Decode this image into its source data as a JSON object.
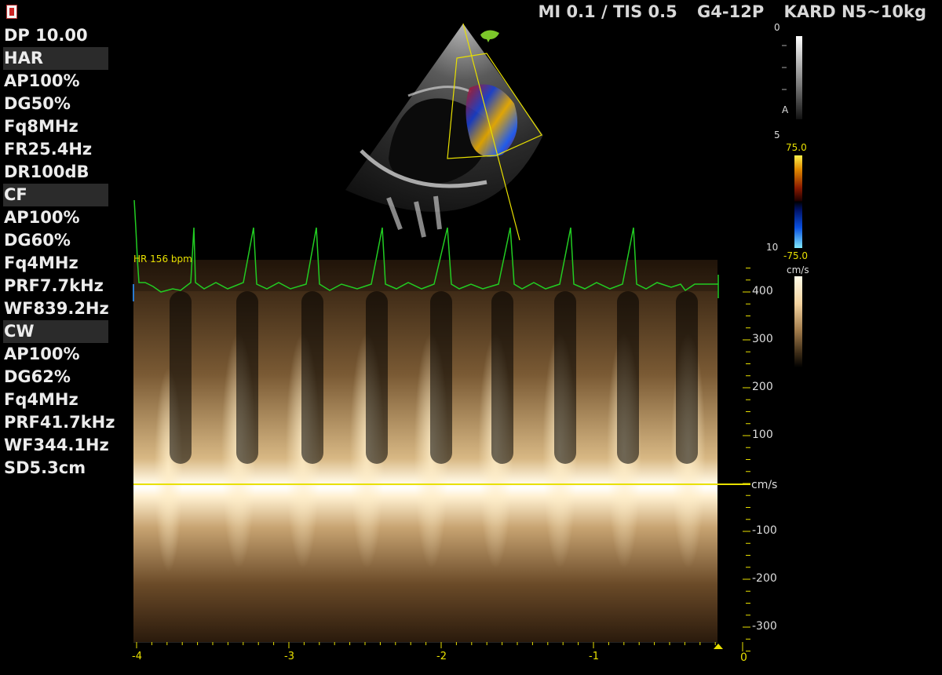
{
  "header": {
    "mi_tis": "MI 0.1 / TIS 0.5",
    "probe": "G4-12P",
    "preset": "KARD N5~10kg"
  },
  "params": [
    {
      "label": "DP 10.00",
      "mode": false
    },
    {
      "label": "HAR",
      "mode": true
    },
    {
      "label": "AP100%",
      "mode": false
    },
    {
      "label": "DG50%",
      "mode": false
    },
    {
      "label": "Fq8MHz",
      "mode": false
    },
    {
      "label": "FR25.4Hz",
      "mode": false
    },
    {
      "label": "DR100dB",
      "mode": false
    },
    {
      "label": "CF",
      "mode": true
    },
    {
      "label": "AP100%",
      "mode": false
    },
    {
      "label": "DG60%",
      "mode": false
    },
    {
      "label": "Fq4MHz",
      "mode": false
    },
    {
      "label": "PRF7.7kHz",
      "mode": false
    },
    {
      "label": "WF839.2Hz",
      "mode": false
    },
    {
      "label": "CW",
      "mode": true
    },
    {
      "label": "AP100%",
      "mode": false
    },
    {
      "label": "DG62%",
      "mode": false
    },
    {
      "label": "Fq4MHz",
      "mode": false
    },
    {
      "label": "PRF41.7kHz",
      "mode": false
    },
    {
      "label": "WF344.1Hz",
      "mode": false
    },
    {
      "label": "SD5.3cm",
      "mode": false
    }
  ],
  "depth_scale": {
    "top": "0",
    "mid": "5",
    "bottom": "10",
    "marker": "A"
  },
  "color_scale": {
    "max": "75.0",
    "min": "-75.0",
    "unit": "cm/s"
  },
  "hr_label": "HR 156 bpm",
  "velocity_scale": {
    "unit": "cm/s",
    "ticks": [
      "400",
      "300",
      "200",
      "100",
      "-100",
      "-200",
      "-300"
    ]
  },
  "time_axis": {
    "labels": [
      "-4",
      "-3",
      "-2",
      "-1"
    ],
    "zero": "0"
  },
  "colors": {
    "accent": "#e8e000",
    "ecg": "#22cc22",
    "doppler": "#f4d4a0"
  }
}
